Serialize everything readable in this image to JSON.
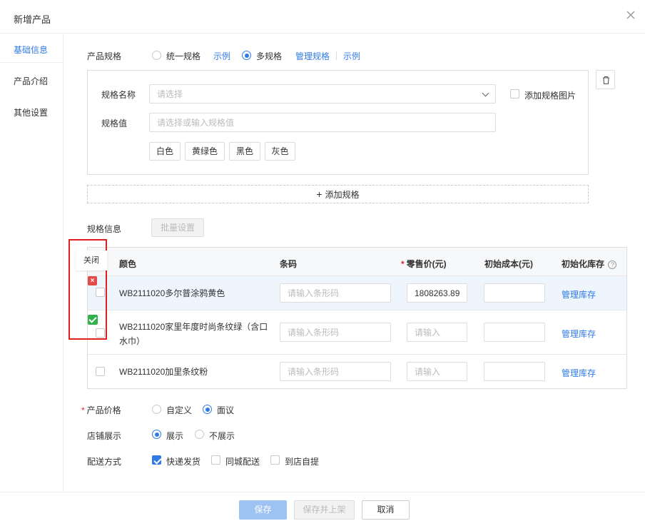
{
  "dialog": {
    "title": "新增产品"
  },
  "sidebar": {
    "items": [
      {
        "label": "基础信息"
      },
      {
        "label": "产品介绍"
      },
      {
        "label": "其他设置"
      }
    ]
  },
  "spec_mode": {
    "label": "产品规格",
    "option_uniform": "统一规格",
    "example1": "示例",
    "option_multi": "多规格",
    "manage": "管理规格",
    "example2": "示例",
    "selected": "多规格"
  },
  "spec_box": {
    "name_label": "规格名称",
    "name_placeholder": "请选择",
    "add_image_label": "添加规格图片",
    "value_label": "规格值",
    "value_placeholder": "请选择或输入规格值",
    "tags": [
      "白色",
      "黄绿色",
      "黑色",
      "灰色"
    ]
  },
  "add_spec": {
    "label": "添加规格",
    "icon": "plus-icon"
  },
  "spec_info": {
    "label": "规格信息",
    "batch_button": "批量设置"
  },
  "table": {
    "headers": {
      "color": "颜色",
      "barcode": "条码",
      "retail_price": "零售价(元)",
      "initial_cost": "初始成本(元)",
      "initial_stock": "初始化库存"
    },
    "barcode_placeholder": "请输入条形码",
    "price_placeholder": "请输入",
    "rows": [
      {
        "name": "WB2111020多尔普涂鸦黄色",
        "price": "1808263.89",
        "action": "管理库存"
      },
      {
        "name": "WB2111020家里年度时尚条纹绿（含口水巾）",
        "price": "",
        "action": "管理库存"
      },
      {
        "name": "WB2111020加里条纹粉",
        "price": "",
        "action": "管理库存"
      }
    ]
  },
  "overlay": {
    "close_label": "关闭",
    "x_mark": "×"
  },
  "price": {
    "label": "产品价格",
    "opt_custom": "自定义",
    "opt_negotiable": "面议",
    "selected": "面议"
  },
  "shop_display": {
    "label": "店铺展示",
    "opt_show": "展示",
    "opt_hide": "不展示",
    "selected": "展示"
  },
  "delivery": {
    "label": "配送方式",
    "opt_express": "快递发货",
    "opt_local": "同城配送",
    "opt_pickup": "到店自提",
    "checked": [
      "快递发货"
    ]
  },
  "footer": {
    "save": "保存",
    "save_publish": "保存并上架",
    "cancel": "取消"
  },
  "colors": {
    "accent": "#2f7be6",
    "danger": "#e02020",
    "success": "#2fb24a"
  }
}
